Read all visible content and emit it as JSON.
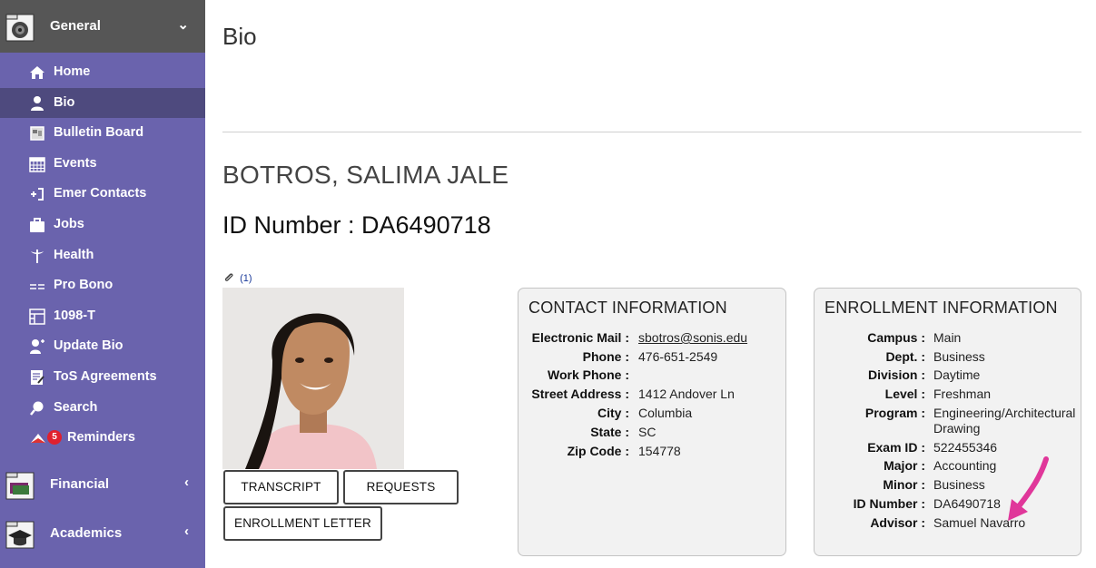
{
  "sidebar": {
    "sections": [
      {
        "label": "General",
        "arrow": "⌄"
      },
      {
        "label": "Financial",
        "arrow": "‹"
      },
      {
        "label": "Academics",
        "arrow": "‹"
      }
    ],
    "items": [
      {
        "label": "Home",
        "icon": "home-icon"
      },
      {
        "label": "Bio",
        "icon": "person-icon"
      },
      {
        "label": "Bulletin Board",
        "icon": "bulletin-icon"
      },
      {
        "label": "Events",
        "icon": "calendar-icon"
      },
      {
        "label": "Emer Contacts",
        "icon": "emergency-contact-icon"
      },
      {
        "label": "Jobs",
        "icon": "briefcase-icon"
      },
      {
        "label": "Health",
        "icon": "caduceus-icon"
      },
      {
        "label": "Pro Bono",
        "icon": "pro-bono-icon"
      },
      {
        "label": "1098-T",
        "icon": "tax-form-icon"
      },
      {
        "label": "Update Bio",
        "icon": "update-person-icon"
      },
      {
        "label": "ToS Agreements",
        "icon": "agreement-icon"
      },
      {
        "label": "Search",
        "icon": "search-icon"
      },
      {
        "label": "Reminders",
        "icon": "reminder-icon",
        "badge": "5"
      }
    ]
  },
  "main": {
    "page_title": "Bio",
    "student_name": "BOTROS, SALIMA JALE",
    "id_heading": "ID Number : DA6490718",
    "attachments": "(1)",
    "buttons": {
      "transcript": "TRANSCRIPT",
      "requests": "REQUESTS",
      "enrollment_letter": "ENROLLMENT LETTER"
    }
  },
  "contact": {
    "title": "CONTACT INFORMATION",
    "rows": [
      {
        "label": "Electronic Mail :",
        "value": "sbotros@sonis.edu"
      },
      {
        "label": "Phone :",
        "value": "476-651-2549"
      },
      {
        "label": "Work Phone :",
        "value": ""
      },
      {
        "label": "Street Address :",
        "value": "1412 Andover Ln"
      },
      {
        "label": "City :",
        "value": "Columbia"
      },
      {
        "label": "State :",
        "value": "SC"
      },
      {
        "label": "Zip Code :",
        "value": "154778"
      }
    ]
  },
  "enrollment": {
    "title": "ENROLLMENT INFORMATION",
    "rows": [
      {
        "label": "Campus :",
        "value": "Main"
      },
      {
        "label": "Dept. :",
        "value": "Business"
      },
      {
        "label": "Division :",
        "value": "Daytime"
      },
      {
        "label": "Level :",
        "value": "Freshman"
      },
      {
        "label": "Program :",
        "value": "Engineering/Architectural",
        "value2": "Drawing"
      },
      {
        "label": "Exam ID :",
        "value": "522455346"
      },
      {
        "label": "Major :",
        "value": "Accounting"
      },
      {
        "label": "Minor :",
        "value": "Business"
      },
      {
        "label": "ID Number :",
        "value": "DA6490718"
      },
      {
        "label": "Advisor :",
        "value": "Samuel Navarro"
      }
    ]
  },
  "colors": {
    "sidebar_bg": "#6a63ad",
    "sidebar_active_item": "#4e4a7e",
    "section_head_active": "#565656",
    "annotation_arrow": "#e0379a",
    "badge": "#e0202e"
  }
}
